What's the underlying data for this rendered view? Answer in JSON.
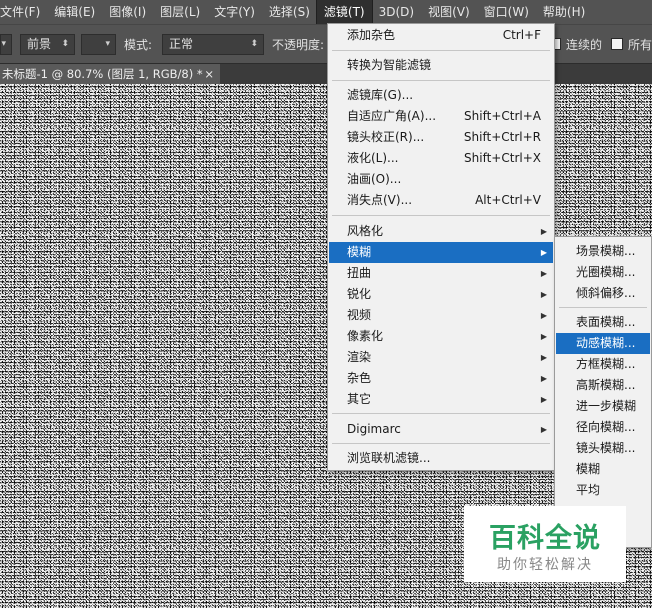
{
  "menubar": {
    "items": [
      "文件(F)",
      "编辑(E)",
      "图像(I)",
      "图层(L)",
      "文字(Y)",
      "选择(S)",
      "滤镜(T)",
      "3D(D)",
      "视图(V)",
      "窗口(W)",
      "帮助(H)"
    ],
    "active": "滤镜(T)"
  },
  "options_bar": {
    "source_value": "前景",
    "mode_label": "模式:",
    "mode_value": "正常",
    "opacity_label": "不透明度:",
    "contiguous_label": "连续的",
    "contiguous_checked": true,
    "all_layers_label": "所有"
  },
  "document": {
    "tab_title": "未标题-1 @ 80.7% (图层 1, RGB/8) *",
    "close_symbol": "×"
  },
  "filter_menu": {
    "items": [
      {
        "label": "添加杂色",
        "shortcut": "Ctrl+F"
      },
      {
        "label": "转换为智能滤镜",
        "shortcut": ""
      },
      {
        "label": "滤镜库(G)...",
        "shortcut": ""
      },
      {
        "label": "自适应广角(A)...",
        "shortcut": "Shift+Ctrl+A"
      },
      {
        "label": "镜头校正(R)...",
        "shortcut": "Shift+Ctrl+R"
      },
      {
        "label": "液化(L)...",
        "shortcut": "Shift+Ctrl+X"
      },
      {
        "label": "油画(O)...",
        "shortcut": ""
      },
      {
        "label": "消失点(V)...",
        "shortcut": "Alt+Ctrl+V"
      },
      {
        "label": "风格化",
        "submenu": true
      },
      {
        "label": "模糊",
        "submenu": true,
        "highlighted": true
      },
      {
        "label": "扭曲",
        "submenu": true
      },
      {
        "label": "锐化",
        "submenu": true
      },
      {
        "label": "视频",
        "submenu": true
      },
      {
        "label": "像素化",
        "submenu": true
      },
      {
        "label": "渲染",
        "submenu": true
      },
      {
        "label": "杂色",
        "submenu": true
      },
      {
        "label": "其它",
        "submenu": true
      },
      {
        "label": "Digimarc",
        "submenu": true
      },
      {
        "label": "浏览联机滤镜...",
        "shortcut": ""
      }
    ]
  },
  "blur_submenu": {
    "items": [
      {
        "label": "场景模糊..."
      },
      {
        "label": "光圈模糊..."
      },
      {
        "label": "倾斜偏移..."
      },
      {
        "label": "表面模糊..."
      },
      {
        "label": "动感模糊...",
        "highlighted": true
      },
      {
        "label": "方框模糊..."
      },
      {
        "label": "高斯模糊..."
      },
      {
        "label": "进一步模糊"
      },
      {
        "label": "径向模糊..."
      },
      {
        "label": "镜头模糊..."
      },
      {
        "label": "模糊"
      },
      {
        "label": "平均"
      }
    ]
  },
  "watermark": {
    "title": "百科全说",
    "subtitle": "助你轻松解决"
  },
  "colors": {
    "menu_highlight": "#1a6ec2",
    "watermark_green": "#2aa162"
  }
}
